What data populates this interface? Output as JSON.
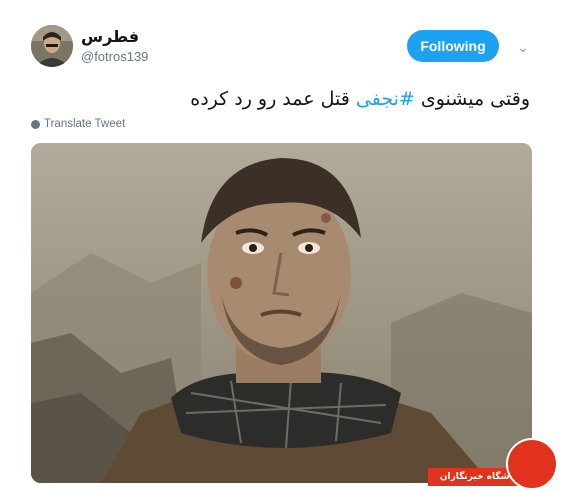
{
  "tweet": {
    "display_name": "فطرس",
    "handle": "@fotros139",
    "follow_label": "Following",
    "text_before": "وقتی میشنوی ",
    "hashtag": "#نجفی",
    "text_after": " قتل عمد رو رد کرده",
    "translate_label": "Translate Tweet"
  },
  "watermark": {
    "text": "باشگاه خبرنگاران"
  },
  "colors": {
    "accent": "#1da1f2",
    "watermark_red": "#e1321e"
  },
  "icons": {
    "caret": "chevron-down-icon",
    "translate": "globe-icon"
  }
}
